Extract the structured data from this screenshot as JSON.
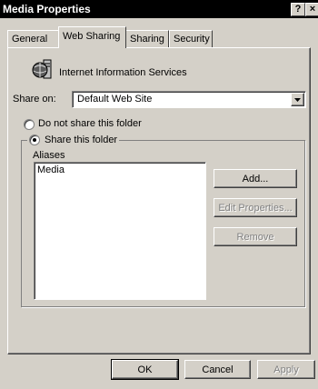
{
  "window": {
    "title": "Media Properties",
    "help_glyph": "?",
    "close_glyph": "×"
  },
  "tabs": [
    {
      "label": "General",
      "active": false
    },
    {
      "label": "Web Sharing",
      "active": true
    },
    {
      "label": "Sharing",
      "active": false
    },
    {
      "label": "Security",
      "active": false
    }
  ],
  "iis": {
    "label": "Internet Information Services",
    "icon": "globe-server-icon"
  },
  "share_on": {
    "label": "Share on:",
    "value": "Default Web Site"
  },
  "radio": {
    "do_not_share": "Do not share this folder",
    "share": "Share this folder",
    "selected": "share"
  },
  "aliases": {
    "label": "Aliases",
    "items": [
      "Media"
    ]
  },
  "alias_buttons": {
    "add": "Add...",
    "edit": "Edit Properties...",
    "remove": "Remove"
  },
  "footer": {
    "ok": "OK",
    "cancel": "Cancel",
    "apply": "Apply"
  }
}
